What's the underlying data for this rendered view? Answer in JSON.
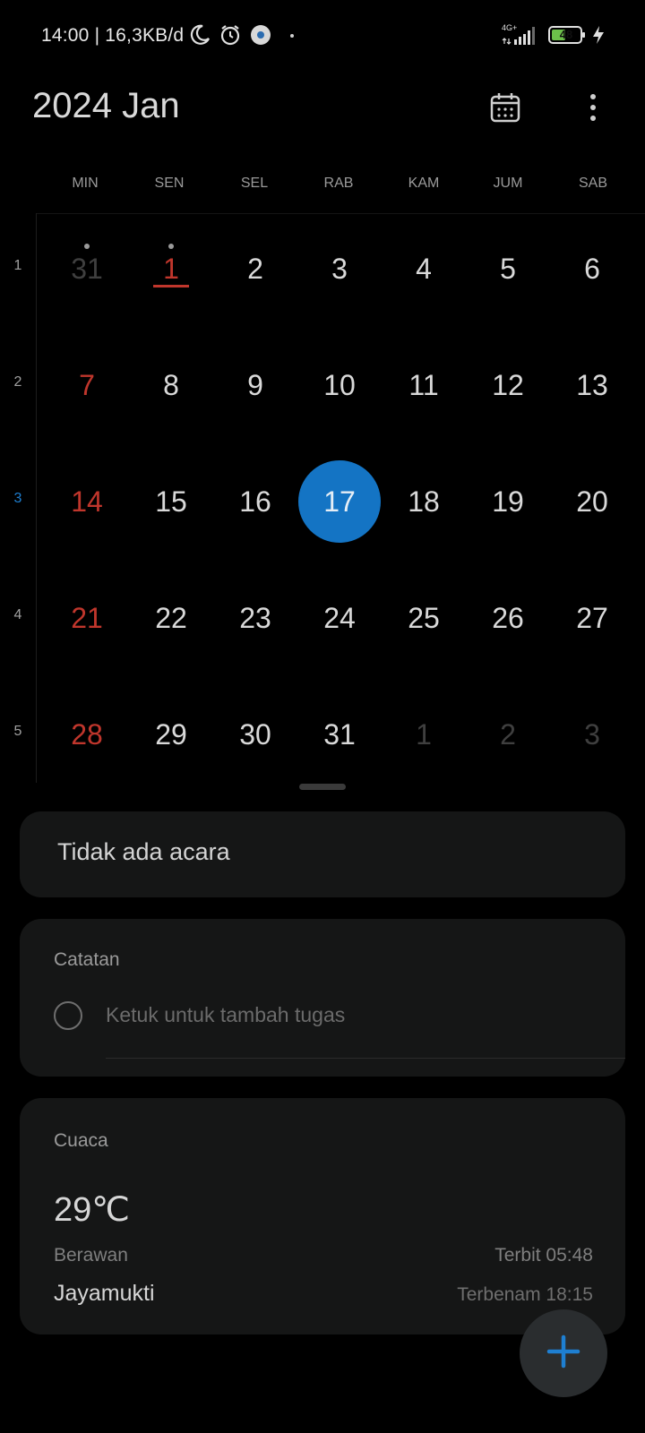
{
  "status": {
    "time_speed": "14:00 | 16,3KB/d",
    "network": "4G+",
    "battery": "48",
    "icons": [
      "moon-icon",
      "alarm-icon",
      "app-notification-icon",
      "dot-icon",
      "signal-icon",
      "battery-icon",
      "charging-icon"
    ]
  },
  "header": {
    "title": "2024 Jan",
    "icons": [
      "calendar-icon",
      "more-vertical-icon"
    ]
  },
  "weekdays": [
    "MIN",
    "SEN",
    "SEL",
    "RAB",
    "KAM",
    "JUM",
    "SAB"
  ],
  "weeks": [
    {
      "num": "1",
      "days": [
        "31",
        "1",
        "2",
        "3",
        "4",
        "5",
        "6"
      ]
    },
    {
      "num": "2",
      "days": [
        "7",
        "8",
        "9",
        "10",
        "11",
        "12",
        "13"
      ]
    },
    {
      "num": "3",
      "days": [
        "14",
        "15",
        "16",
        "17",
        "18",
        "19",
        "20"
      ]
    },
    {
      "num": "4",
      "days": [
        "21",
        "22",
        "23",
        "24",
        "25",
        "26",
        "27"
      ]
    },
    {
      "num": "5",
      "days": [
        "28",
        "29",
        "30",
        "31",
        "1",
        "2",
        "3"
      ]
    }
  ],
  "selected_day": "17",
  "events": {
    "empty_text": "Tidak ada acara"
  },
  "notes": {
    "label": "Catatan",
    "placeholder": "Ketuk untuk tambah tugas"
  },
  "weather": {
    "label": "Cuaca",
    "temp": "29℃",
    "condition": "Berawan",
    "location": "Jayamukti",
    "sunrise": "Terbit 05:48",
    "sunset": "Terbenam 18:15"
  },
  "fab": {
    "icon": "plus-icon"
  },
  "colors": {
    "accent": "#1474c4",
    "holiday": "#c0362c",
    "background": "#000000",
    "card": "#151616"
  }
}
